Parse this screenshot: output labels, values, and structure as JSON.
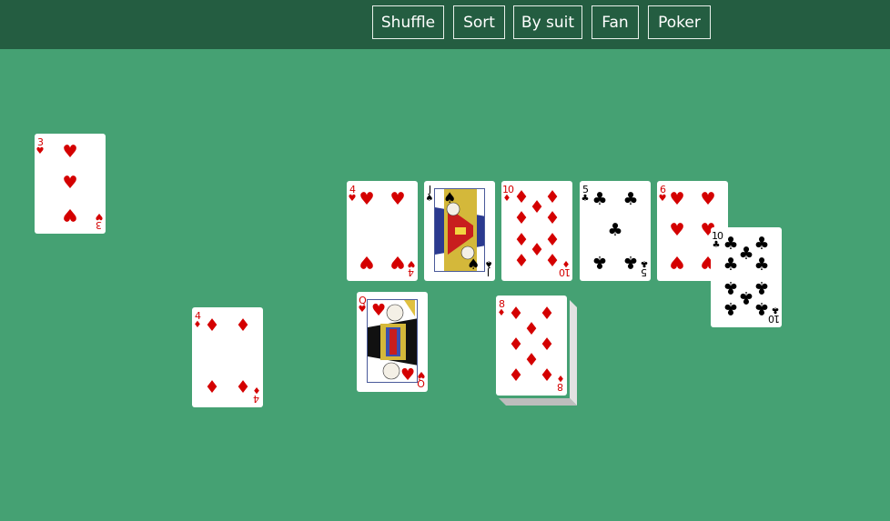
{
  "toolbar": {
    "buttons": [
      "Shuffle",
      "Sort",
      "By suit",
      "Fan",
      "Poker"
    ]
  },
  "colors": {
    "table": "#45a173",
    "topbar": "#245d41",
    "red": "#d40000",
    "black": "#000000"
  },
  "cards": {
    "three_hearts": {
      "rank": "3",
      "suit": "♥"
    },
    "four_diamonds": {
      "rank": "4",
      "suit": "♦"
    },
    "four_hearts": {
      "rank": "4",
      "suit": "♥"
    },
    "jack_spades": {
      "rank": "J",
      "suit": "♠"
    },
    "ten_diamonds": {
      "rank": "10",
      "suit": "♦"
    },
    "five_clubs": {
      "rank": "5",
      "suit": "♣"
    },
    "six_hearts": {
      "rank": "6",
      "suit": "♥"
    },
    "ten_clubs": {
      "rank": "10",
      "suit": "♣"
    },
    "queen_hearts": {
      "rank": "Q",
      "suit": "♥"
    },
    "eight_diamonds": {
      "rank": "8",
      "suit": "♦"
    }
  }
}
